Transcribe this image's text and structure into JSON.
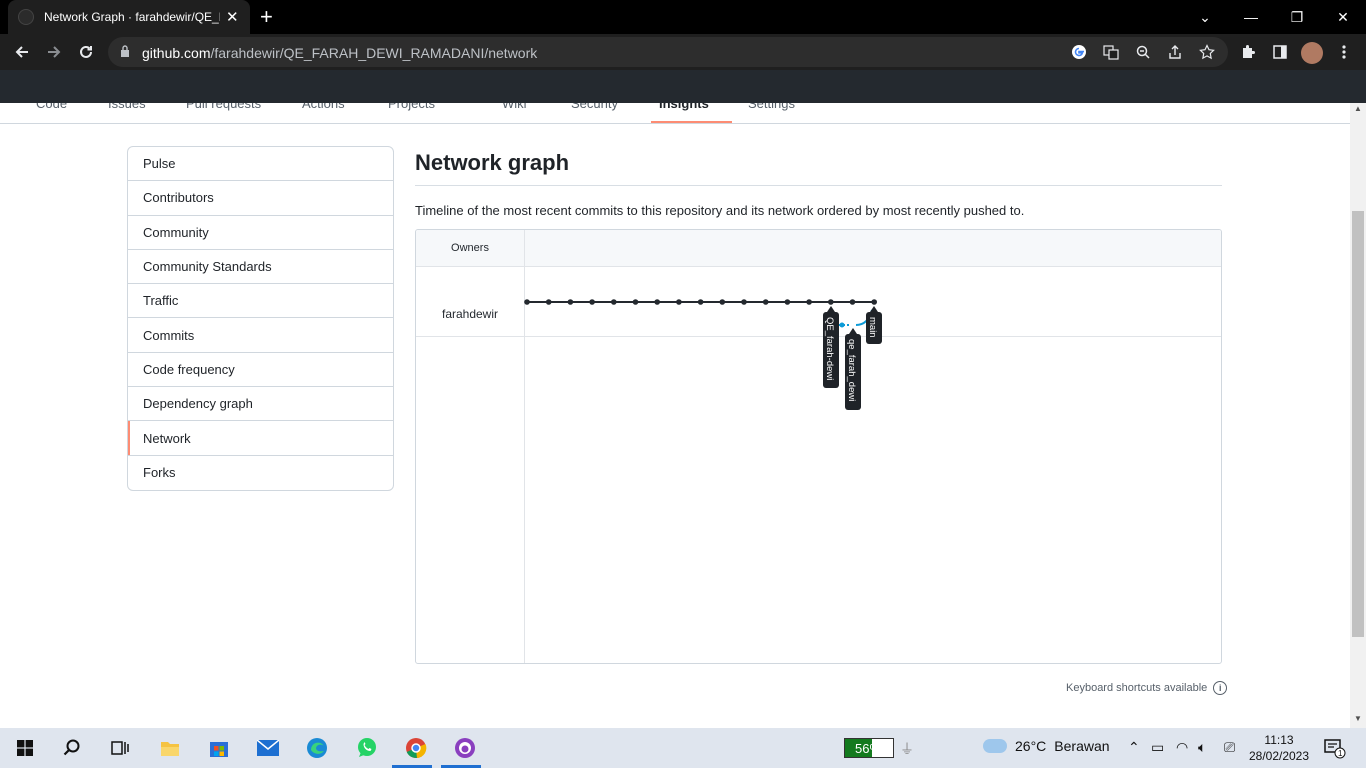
{
  "browser": {
    "tab_title": "Network Graph · farahdewir/QE_F",
    "tab_close": "✕",
    "new_tab": "+",
    "url_host": "github.com",
    "url_path": "/farahdewir/QE_FARAH_DEWI_RAMADANI/network",
    "window_controls": [
      "⌄",
      "—",
      "❐",
      "✕"
    ]
  },
  "repo_nav": {
    "tabs": [
      {
        "label": "Code"
      },
      {
        "label": "Issues"
      },
      {
        "label": "Pull requests"
      },
      {
        "label": "Actions"
      },
      {
        "label": "Projects"
      },
      {
        "label": "Wiki"
      },
      {
        "label": "Security"
      },
      {
        "label": "Insights",
        "active": true
      },
      {
        "label": "Settings"
      }
    ]
  },
  "sidebar": {
    "items": [
      {
        "label": "Pulse"
      },
      {
        "label": "Contributors"
      },
      {
        "label": "Community"
      },
      {
        "label": "Community Standards"
      },
      {
        "label": "Traffic"
      },
      {
        "label": "Commits"
      },
      {
        "label": "Code frequency"
      },
      {
        "label": "Dependency graph"
      },
      {
        "label": "Network",
        "selected": true
      },
      {
        "label": "Forks"
      }
    ]
  },
  "main": {
    "title": "Network graph",
    "description": "Timeline of the most recent commits to this repository and its network ordered by most recently pushed to.",
    "owners_header": "Owners",
    "owner": "farahdewir",
    "branches": [
      "QE_farah-dewi",
      "qe_farah_dewi",
      "main"
    ],
    "keyboard_shortcuts": "Keyboard shortcuts available"
  },
  "colors": {
    "accent_underline": "#fd8c73",
    "commit_line": "#24292f",
    "branch_line": "#0d9bd7"
  },
  "taskbar": {
    "battery_percent": "56%",
    "battery_level": 0.56,
    "temperature": "26°C",
    "weather": "Berawan",
    "time": "11:13",
    "date": "28/02/2023",
    "notifications": "1"
  }
}
